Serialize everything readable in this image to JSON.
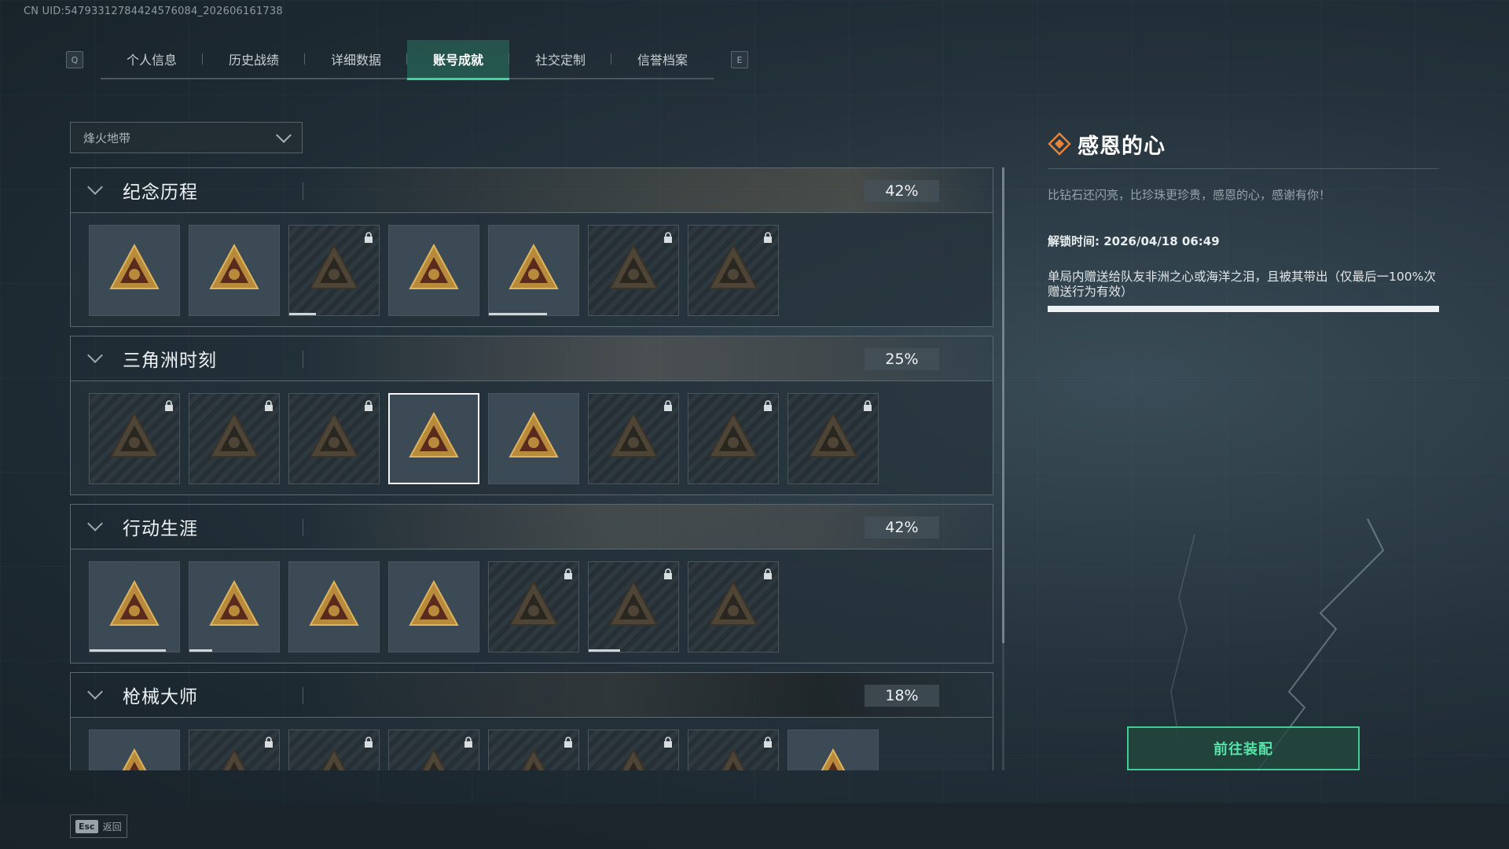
{
  "uid": "CN UID:547933127844245760​84_202606161738",
  "tabs": {
    "left_key": "Q",
    "right_key": "E",
    "items": [
      {
        "label": "个人信息",
        "active": false
      },
      {
        "label": "历史战绩",
        "active": false
      },
      {
        "label": "详细数据",
        "active": false
      },
      {
        "label": "账号成就",
        "active": true
      },
      {
        "label": "社交定制",
        "active": false
      },
      {
        "label": "信誉档案",
        "active": false
      }
    ]
  },
  "filter": {
    "selected": "烽火地带"
  },
  "sections": [
    {
      "title": "纪念历程",
      "percent": "42%",
      "badges": [
        {
          "icon": "triangle-emblem-icon",
          "locked": false,
          "progress": 0
        },
        {
          "icon": "helicopter-icon",
          "locked": false,
          "progress": 0
        },
        {
          "icon": "shield-hex-icon",
          "locked": true,
          "progress": 0.3
        },
        {
          "icon": "season-58-icon",
          "locked": false,
          "progress": 0
        },
        {
          "icon": "season-59-icon",
          "locked": false,
          "progress": 0.65
        },
        {
          "icon": "hooded-figure-icon",
          "locked": true,
          "progress": 0
        },
        {
          "icon": "skull-crossbones-icon",
          "locked": true,
          "progress": 0
        }
      ]
    },
    {
      "title": "三角洲时刻",
      "percent": "25%",
      "badges": [
        {
          "icon": "supply-bottle-icon",
          "locked": true,
          "selected": false,
          "progress": 0
        },
        {
          "icon": "medkit-icon",
          "locked": true,
          "selected": false,
          "progress": 0
        },
        {
          "icon": "kneeling-soldier-icon",
          "locked": true,
          "selected": false,
          "progress": 0
        },
        {
          "icon": "heart-diamond-icon",
          "locked": false,
          "selected": true,
          "progress": 0
        },
        {
          "icon": "squad-icon",
          "locked": false,
          "selected": false,
          "progress": 0
        },
        {
          "icon": "cat-icon",
          "locked": true,
          "selected": false,
          "progress": 0
        },
        {
          "icon": "fish-icon",
          "locked": true,
          "selected": false,
          "progress": 0
        },
        {
          "icon": "rose-diamond-icon",
          "locked": true,
          "selected": false,
          "progress": 0
        }
      ]
    },
    {
      "title": "行动生涯",
      "percent": "42%",
      "badges": [
        {
          "icon": "star-medal-icon",
          "locked": false,
          "progress": 0.85
        },
        {
          "icon": "bronze-shield-icon",
          "locked": false,
          "progress": 0.25
        },
        {
          "icon": "gold-shield-stars-icon",
          "locked": false,
          "progress": 0
        },
        {
          "icon": "red-shield-stars-icon",
          "locked": false,
          "progress": 0
        },
        {
          "icon": "round-emblem-icon",
          "locked": true,
          "progress": 0
        },
        {
          "icon": "masked-operator-icon",
          "locked": true,
          "progress": 0.35
        },
        {
          "icon": "eye-emblem-icon",
          "locked": true,
          "progress": 0
        }
      ]
    },
    {
      "title": "枪械大师",
      "percent": "18%",
      "badges": [
        {
          "icon": "green-crosshair-icon",
          "locked": false,
          "progress": 0
        },
        {
          "icon": "rifle-emblem-icon",
          "locked": true,
          "progress": 0
        },
        {
          "icon": "rifle-emblem-icon",
          "locked": true,
          "progress": 0
        },
        {
          "icon": "rifle-emblem-icon",
          "locked": true,
          "progress": 0
        },
        {
          "icon": "rifle-emblem-icon",
          "locked": true,
          "progress": 0
        },
        {
          "icon": "rifle-emblem-icon",
          "locked": true,
          "progress": 0
        },
        {
          "icon": "rifle-emblem-icon",
          "locked": true,
          "progress": 0
        },
        {
          "icon": "gold-crosshair-icon",
          "locked": false,
          "progress": 0
        }
      ]
    }
  ],
  "detail": {
    "title": "感恩的心",
    "description": "比钻石还闪亮，比珍珠更珍贵，感恩的心，感谢有你！",
    "unlock_time": "解锁时间: 2026/04/18 06:49",
    "requirement": "单局内赠送给队友非洲之心或海洋之泪，且被其带出（仅最后一100%次赠送行为有效）",
    "progress": 1.0
  },
  "equip_button": "前往装配",
  "back": {
    "key": "Esc",
    "label": "返回"
  },
  "colors": {
    "accent": "#3fd49a",
    "title_icon": "#e8833a"
  }
}
